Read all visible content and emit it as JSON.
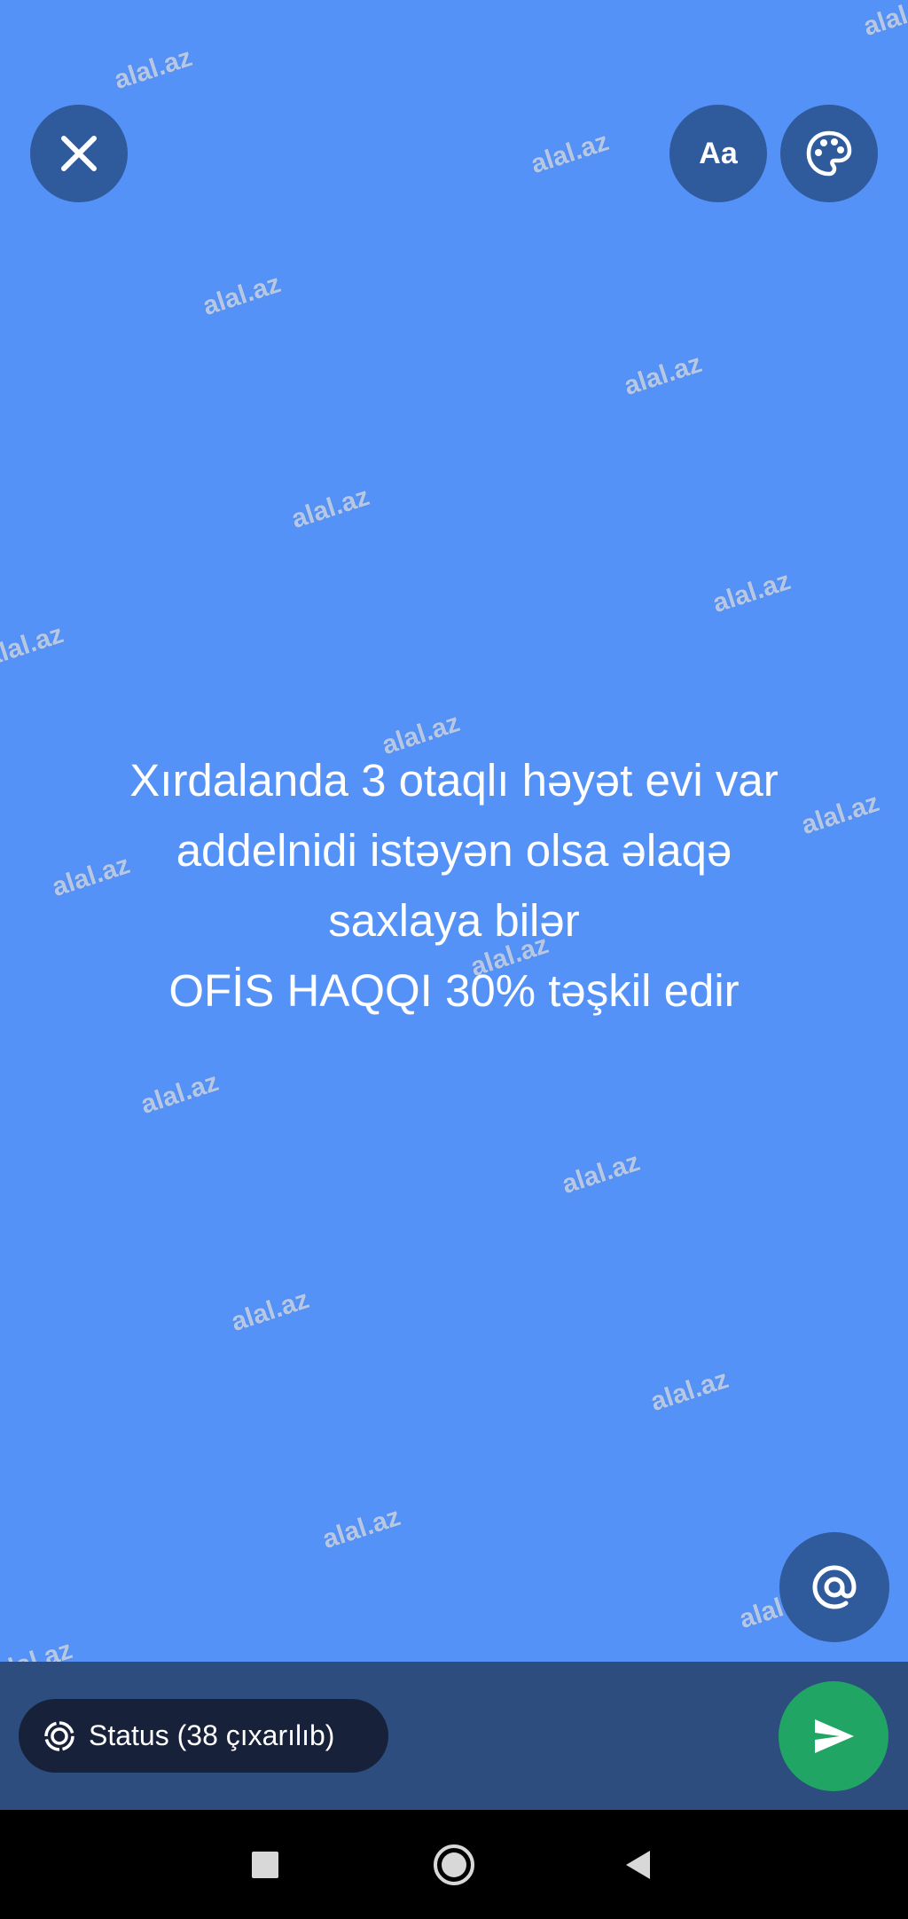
{
  "status_editor": {
    "text_lines": [
      "Xırdalanda 3 otaqlı həyət evi var",
      "addelnidi istəyən olsa əlaqə",
      "saxlaya bilər",
      "OFİS HAQQI 30% təşkil edir"
    ],
    "background_color": "#5592f7"
  },
  "toolbar": {
    "close_icon": "close-icon",
    "font_label": "Aa",
    "palette_icon": "palette-icon"
  },
  "mention_icon": "at-sign-icon",
  "bottom_bar": {
    "audience_label": "Status (38 çıxarılıb)",
    "audience_icon": "status-ring-icon",
    "send_icon": "send-icon",
    "send_color": "#21a565"
  },
  "watermark": {
    "text": "alal.az"
  },
  "nav": {
    "recents_icon": "square-icon",
    "home_icon": "circle-icon",
    "back_icon": "triangle-back-icon"
  }
}
